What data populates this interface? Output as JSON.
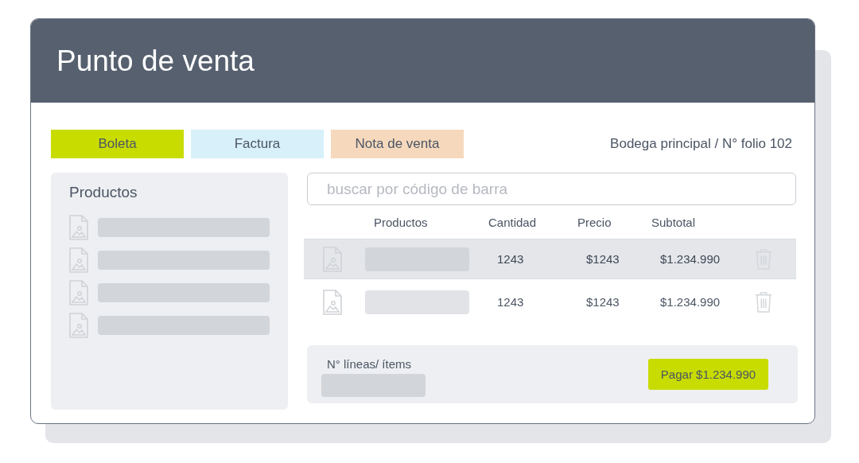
{
  "window": {
    "title": "Punto de venta"
  },
  "document_types": [
    {
      "label": "Boleta",
      "color": "#c8dc00"
    },
    {
      "label": "Factura",
      "color": "#d8f0fa"
    },
    {
      "label": "Nota de venta",
      "color": "#f6d9bd"
    }
  ],
  "location": "Bodega principal / N° folio 102",
  "products_panel": {
    "title": "Productos",
    "items": [
      {
        "kind": "placeholder"
      },
      {
        "kind": "placeholder"
      },
      {
        "kind": "placeholder"
      },
      {
        "kind": "placeholder"
      }
    ]
  },
  "search": {
    "placeholder": "buscar por código de barra"
  },
  "table": {
    "columns": [
      "Productos",
      "Cantidad",
      "Precio",
      "Subtotal"
    ],
    "rows": [
      {
        "selected": true,
        "quantity": "1243",
        "price": "$1243",
        "subtotal": "$1.234.990"
      },
      {
        "selected": false,
        "quantity": "1243",
        "price": "$1243",
        "subtotal": "$1.234.990"
      }
    ]
  },
  "footer": {
    "label": "N° líneas/ ítems",
    "pay_button": "Pagar $1.234.990"
  }
}
